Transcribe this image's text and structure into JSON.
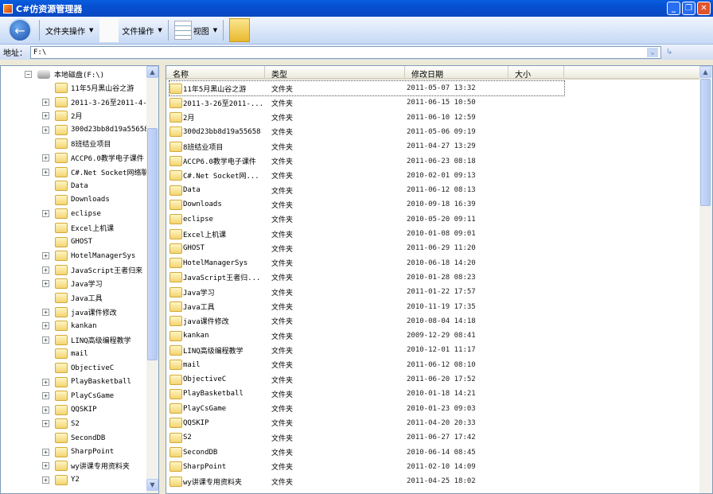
{
  "window": {
    "title": "C#仿资源管理器",
    "min": "_",
    "max": "❐",
    "close": "✕"
  },
  "toolbar": {
    "back": "←",
    "folder_ops": "文件夹操作",
    "file_ops": "文件操作",
    "view": "视图",
    "arrow": "▼"
  },
  "address": {
    "label": "地址：",
    "value": "F:\\",
    "dropdown": "⌄",
    "go": "↳"
  },
  "tree": {
    "root": "本地磁盘(F:\\)",
    "items": [
      {
        "name": "11年5月黑山谷之游",
        "exp": false
      },
      {
        "name": "2011-3-26至2011-4-",
        "exp": true
      },
      {
        "name": "2月",
        "exp": true
      },
      {
        "name": "300d23bb8d19a55658",
        "exp": true
      },
      {
        "name": "8班结业项目",
        "exp": false
      },
      {
        "name": "ACCP6.0教学电子课件",
        "exp": true
      },
      {
        "name": "C#.Net Socket网络聊",
        "exp": true
      },
      {
        "name": "Data",
        "exp": false
      },
      {
        "name": "Downloads",
        "exp": false
      },
      {
        "name": "eclipse",
        "exp": true
      },
      {
        "name": "Excel上机课",
        "exp": false
      },
      {
        "name": "GHOST",
        "exp": false
      },
      {
        "name": "HotelManagerSys",
        "exp": true
      },
      {
        "name": "JavaScript王者归来",
        "exp": true
      },
      {
        "name": "Java学习",
        "exp": true
      },
      {
        "name": "Java工具",
        "exp": false
      },
      {
        "name": "java课件修改",
        "exp": true
      },
      {
        "name": "kankan",
        "exp": true
      },
      {
        "name": "LINQ高级编程教学",
        "exp": true
      },
      {
        "name": "mail",
        "exp": false
      },
      {
        "name": "ObjectiveC",
        "exp": false
      },
      {
        "name": "PlayBasketball",
        "exp": true
      },
      {
        "name": "PlayCsGame",
        "exp": true
      },
      {
        "name": "QQSKIP",
        "exp": true
      },
      {
        "name": "S2",
        "exp": true
      },
      {
        "name": "SecondDB",
        "exp": false
      },
      {
        "name": "SharpPoint",
        "exp": true
      },
      {
        "name": "wy讲课专用资料夹",
        "exp": true
      },
      {
        "name": "Y2",
        "exp": true
      }
    ]
  },
  "list": {
    "columns": [
      "名称",
      "类型",
      "修改日期",
      "大小"
    ],
    "rows": [
      [
        "11年5月黑山谷之游",
        "文件夹",
        "2011-05-07 13:32"
      ],
      [
        "2011-3-26至2011-...",
        "文件夹",
        "2011-06-15 10:50"
      ],
      [
        "2月",
        "文件夹",
        "2011-06-10 12:59"
      ],
      [
        "300d23bb8d19a55658",
        "文件夹",
        "2011-05-06 09:19"
      ],
      [
        "8班结业项目",
        "文件夹",
        "2011-04-27 13:29"
      ],
      [
        "ACCP6.0教学电子课件",
        "文件夹",
        "2011-06-23 08:18"
      ],
      [
        "C#.Net Socket网...",
        "文件夹",
        "2010-02-01 09:13"
      ],
      [
        "Data",
        "文件夹",
        "2011-06-12 08:13"
      ],
      [
        "Downloads",
        "文件夹",
        "2010-09-18 16:39"
      ],
      [
        "eclipse",
        "文件夹",
        "2010-05-20 09:11"
      ],
      [
        "Excel上机课",
        "文件夹",
        "2010-01-08 09:01"
      ],
      [
        "GHOST",
        "文件夹",
        "2011-06-29 11:20"
      ],
      [
        "HotelManagerSys",
        "文件夹",
        "2010-06-18 14:20"
      ],
      [
        "JavaScript王者归...",
        "文件夹",
        "2010-01-28 08:23"
      ],
      [
        "Java学习",
        "文件夹",
        "2011-01-22 17:57"
      ],
      [
        "Java工具",
        "文件夹",
        "2010-11-19 17:35"
      ],
      [
        "java课件修改",
        "文件夹",
        "2010-08-04 14:18"
      ],
      [
        "kankan",
        "文件夹",
        "2009-12-29 08:41"
      ],
      [
        "LINQ高级编程教学",
        "文件夹",
        "2010-12-01 11:17"
      ],
      [
        "mail",
        "文件夹",
        "2011-06-12 08:10"
      ],
      [
        "ObjectiveC",
        "文件夹",
        "2011-06-20 17:52"
      ],
      [
        "PlayBasketball",
        "文件夹",
        "2010-01-18 14:21"
      ],
      [
        "PlayCsGame",
        "文件夹",
        "2010-01-23 09:03"
      ],
      [
        "QQSKIP",
        "文件夹",
        "2011-04-20 20:33"
      ],
      [
        "S2",
        "文件夹",
        "2011-06-27 17:42"
      ],
      [
        "SecondDB",
        "文件夹",
        "2010-06-14 08:45"
      ],
      [
        "SharpPoint",
        "文件夹",
        "2011-02-10 14:09"
      ],
      [
        "wy讲课专用资料夹",
        "文件夹",
        "2011-04-25 18:02"
      ]
    ]
  },
  "scroll": {
    "up": "▲",
    "down": "▼"
  }
}
